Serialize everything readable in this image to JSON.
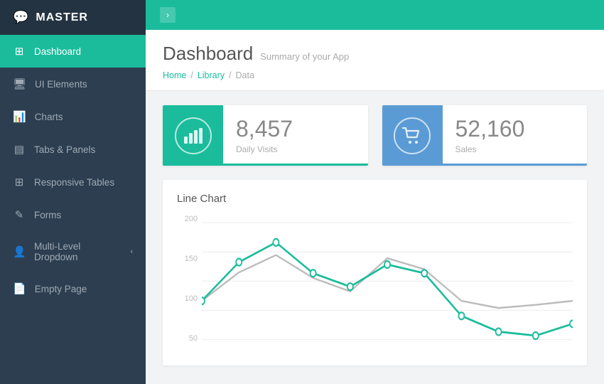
{
  "app": {
    "logo_icon": "💬",
    "logo_text": "MASTER"
  },
  "sidebar": {
    "items": [
      {
        "id": "dashboard",
        "label": "Dashboard",
        "icon": "⊞",
        "active": true
      },
      {
        "id": "ui-elements",
        "label": "UI Elements",
        "icon": "🖥",
        "active": false
      },
      {
        "id": "charts",
        "label": "Charts",
        "icon": "📊",
        "active": false
      },
      {
        "id": "tabs-panels",
        "label": "Tabs & Panels",
        "icon": "▤",
        "active": false
      },
      {
        "id": "responsive-tables",
        "label": "Responsive Tables",
        "icon": "⊞",
        "active": false
      },
      {
        "id": "forms",
        "label": "Forms",
        "icon": "✎",
        "active": false
      },
      {
        "id": "multi-level",
        "label": "Multi-Level Dropdown",
        "icon": "👤",
        "active": false,
        "has_chevron": true
      },
      {
        "id": "empty-page",
        "label": "Empty Page",
        "icon": "📄",
        "active": false
      }
    ]
  },
  "header": {
    "page_title": "Dashboard",
    "page_subtitle": "Summary of your App",
    "breadcrumb": [
      "Home",
      "Library",
      "Data"
    ]
  },
  "stats": [
    {
      "id": "daily-visits",
      "value": "8,457",
      "label": "Daily Visits",
      "color": "green",
      "icon": "bars"
    },
    {
      "id": "sales",
      "value": "52,160",
      "label": "Sales",
      "color": "blue",
      "icon": "cart"
    }
  ],
  "chart": {
    "title": "Line Chart",
    "y_labels": [
      "200",
      "150",
      "100",
      "50"
    ],
    "series": {
      "teal": [
        100,
        160,
        190,
        140,
        120,
        155,
        145,
        80,
        60,
        55,
        70
      ],
      "gray": [
        100,
        145,
        170,
        130,
        110,
        165,
        150,
        100,
        90,
        95,
        100
      ]
    }
  },
  "colors": {
    "teal": "#1abc9c",
    "blue": "#5b9bd5",
    "sidebar_bg": "#2c3e50",
    "sidebar_active": "#1abc9c",
    "text_dark": "#555",
    "text_light": "#aaa"
  }
}
